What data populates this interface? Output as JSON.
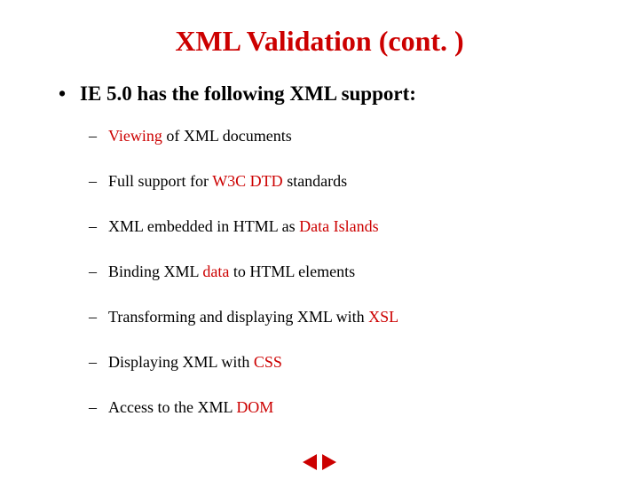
{
  "title": "XML Validation (cont. )",
  "main_bullet": "IE 5.0 has the following XML support:",
  "items": [
    {
      "pre": "",
      "red": "Viewing",
      "post": " of XML documents"
    },
    {
      "pre": "Full support for ",
      "red": "W3C DTD",
      "post": " standards"
    },
    {
      "pre": "XML embedded in HTML as ",
      "red": "Data Islands",
      "post": ""
    },
    {
      "pre": "Binding XML ",
      "red": "data",
      "post": " to HTML elements"
    },
    {
      "pre": "Transforming and displaying XML with ",
      "red": "XSL",
      "post": ""
    },
    {
      "pre": "Displaying XML with ",
      "red": "CSS",
      "post": ""
    },
    {
      "pre": "Access to the XML ",
      "red": "DOM",
      "post": ""
    }
  ],
  "nav": {
    "prev": "previous-slide",
    "next": "next-slide"
  }
}
